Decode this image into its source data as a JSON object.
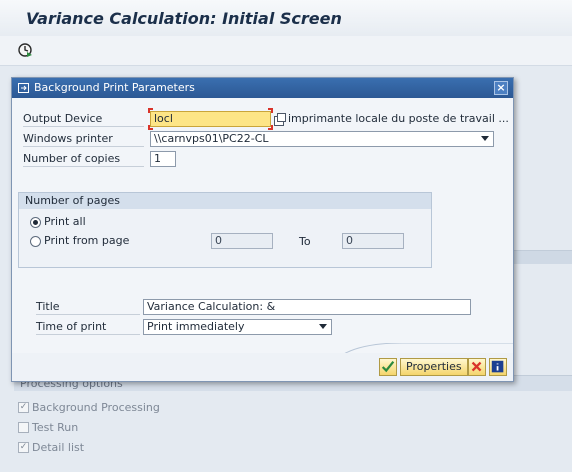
{
  "screen": {
    "title": "Variance Calculation: Initial Screen",
    "toolbar": {
      "execute_icon": "execute-clock-icon"
    }
  },
  "background": {
    "group_label": "Processing options",
    "options": [
      {
        "label": "Background Processing",
        "checked": true
      },
      {
        "label": "Test Run",
        "checked": false
      },
      {
        "label": "Detail list",
        "checked": true
      }
    ]
  },
  "dialog": {
    "title": "Background Print Parameters",
    "output_device": {
      "label": "Output Device",
      "value": "locl",
      "description": "imprimante locale du poste de travail ..."
    },
    "windows_printer": {
      "label": "Windows printer",
      "value": "\\\\carnvps01\\PC22-CL"
    },
    "copies": {
      "label": "Number of copies",
      "value": "1"
    },
    "pages_group": {
      "label": "Number of pages",
      "print_all": "Print all",
      "print_from": "Print from page",
      "from_value": "0",
      "to_label": "To",
      "to_value": "0",
      "selected": "print_all"
    },
    "title_field": {
      "label": "Title",
      "value": "Variance Calculation: &"
    },
    "time_of_print": {
      "label": "Time of print",
      "value": "Print immediately"
    },
    "buttons": {
      "ok_icon": "checkmark-icon",
      "properties": "Properties",
      "cancel_icon": "cancel-x-icon",
      "help_icon": "info-icon"
    }
  },
  "colors": {
    "title_bar": "#2c5894",
    "active_field": "#fde586",
    "accent_red": "#d9342b"
  }
}
